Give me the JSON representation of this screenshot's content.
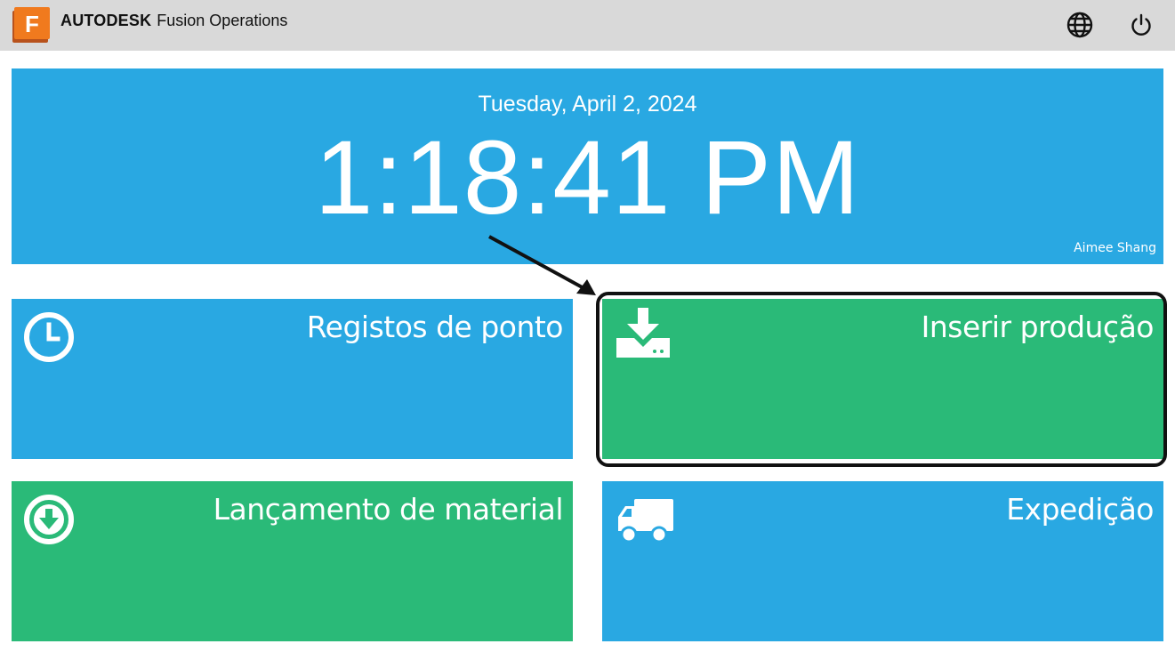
{
  "app": {
    "logo_letter": "F",
    "brand_bold": "AUTODESK",
    "brand_product": "Fusion Operations",
    "icons": {
      "globe": "globe-icon",
      "power": "power-icon"
    }
  },
  "clock": {
    "date": "Tuesday, April 2, 2024",
    "time": "1:18:41 PM",
    "user": "Aimee Shang"
  },
  "tiles": [
    {
      "label": "Registos de ponto",
      "icon": "clock-icon",
      "color": "#29a8e2"
    },
    {
      "label": "Inserir produção",
      "icon": "download-tray-icon",
      "color": "#2aba78",
      "highlighted": true
    },
    {
      "label": "Lançamento de material",
      "icon": "download-circle-icon",
      "color": "#2aba78"
    },
    {
      "label": "Expedição",
      "icon": "truck-icon",
      "color": "#29a8e2"
    }
  ],
  "colors": {
    "topbar": "#d9d9d9",
    "accent_blue": "#29a8e2",
    "accent_green": "#2aba78",
    "highlight_border": "#111111"
  }
}
